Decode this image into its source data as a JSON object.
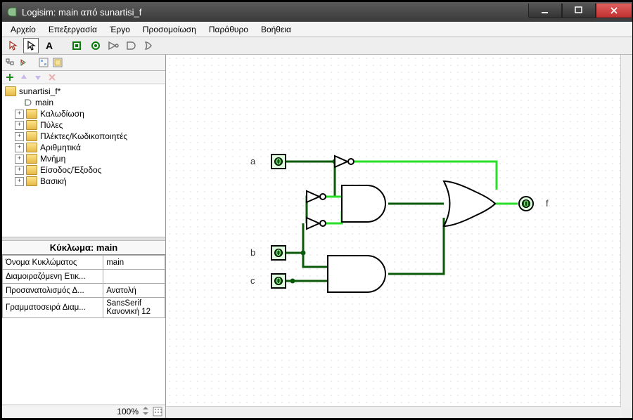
{
  "title": "Logisim: main από sunartisi_f",
  "menus": [
    "Αρχείο",
    "Επεξεργασία",
    "Έργο",
    "Προσομοίωση",
    "Παράθυρο",
    "Βοήθεια"
  ],
  "tree": {
    "root": "sunartisi_f*",
    "circuit": "main",
    "libs": [
      "Καλωδίωση",
      "Πύλες",
      "Πλέκτες/Κωδικοποιητές",
      "Αριθμητικά",
      "Μνήμη",
      "Είσοδος/Έξοδος",
      "Βασική"
    ]
  },
  "attrs": {
    "header": "Κύκλωμα: main",
    "rows": [
      [
        "Όνομα Κυκλώματος",
        "main"
      ],
      [
        "Διαμοιραζόμενη Ετικ...",
        ""
      ],
      [
        "Προσανατολισμός Δ...",
        "Ανατολή"
      ],
      [
        "Γραμματοσειρά Διαμ...",
        "SansSerif Κανονική 12"
      ]
    ]
  },
  "zoom": "100%",
  "pins": {
    "a": "a",
    "b": "b",
    "c": "c",
    "f": "f"
  },
  "pinvals": {
    "a": "0",
    "b": "0",
    "c": "0",
    "f": "0"
  }
}
